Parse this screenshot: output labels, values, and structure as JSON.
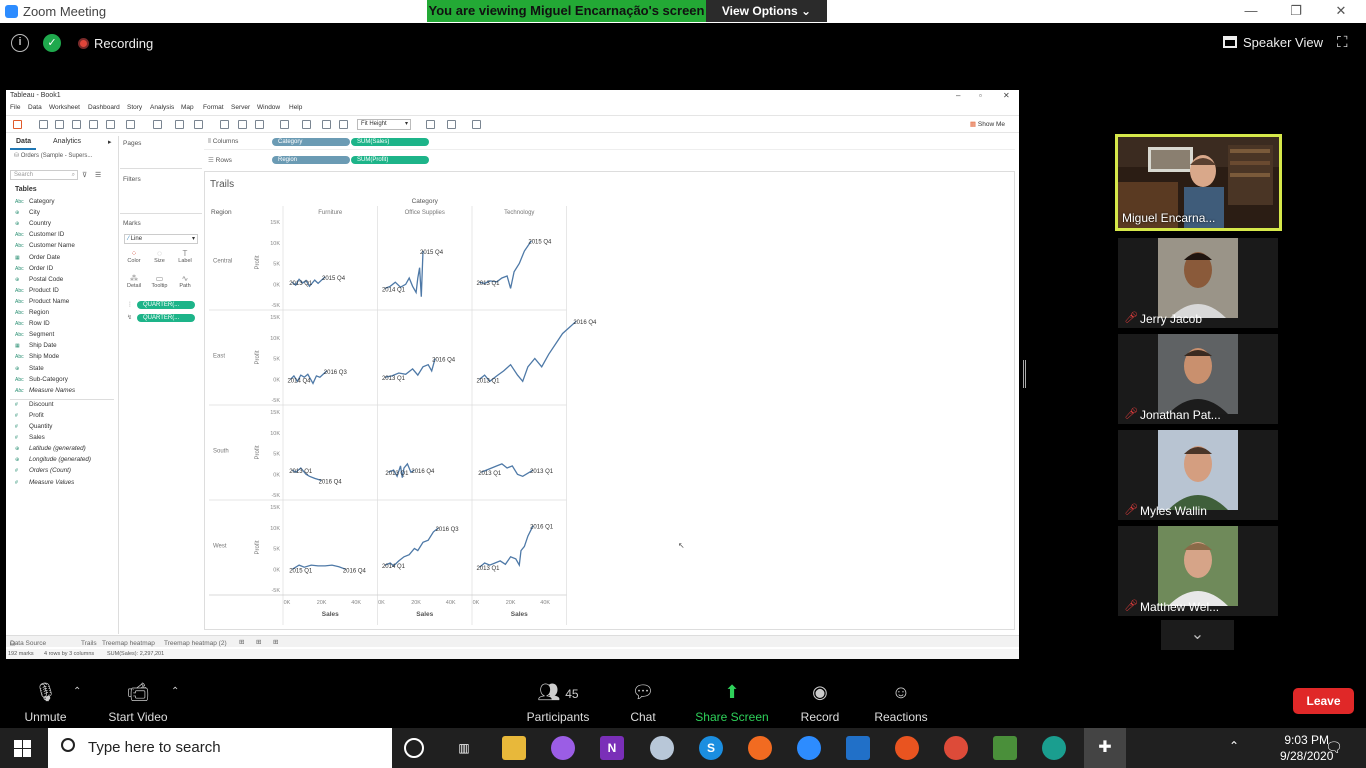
{
  "zoom": {
    "title": "Zoom Meeting",
    "banner": "You are viewing Miguel Encarnação's screen",
    "view_options": "View Options",
    "recording": "Recording",
    "speaker_view": "Speaker View"
  },
  "tableau": {
    "window_title": "Tableau - Book1",
    "menu": [
      "File",
      "Data",
      "Worksheet",
      "Dashboard",
      "Story",
      "Analysis",
      "Map",
      "Format",
      "Server",
      "Window",
      "Help"
    ],
    "fit": "Fit Height",
    "show_me": "Show Me",
    "data_tab": "Data",
    "analytics_tab": "Analytics",
    "datasource": "Orders (Sample - Supers...",
    "search_placeholder": "Search",
    "tables_heading": "Tables",
    "dimensions": [
      "Category",
      "City",
      "Country",
      "Customer ID",
      "Customer Name",
      "Order Date",
      "Order ID",
      "Postal Code",
      "Product ID",
      "Product Name",
      "Region",
      "Row ID",
      "Segment",
      "Ship Date",
      "Ship Mode",
      "State",
      "Sub-Category",
      "Measure Names"
    ],
    "measures": [
      "Discount",
      "Profit",
      "Quantity",
      "Sales",
      "Latitude (generated)",
      "Longitude (generated)",
      "Orders (Count)",
      "Measure Values"
    ],
    "pages": "Pages",
    "filters": "Filters",
    "marks": "Marks",
    "mark_type": "Line",
    "mark_buttons": [
      "Color",
      "Size",
      "Label",
      "Detail",
      "Tooltip",
      "Path"
    ],
    "mark_pills": [
      "QUARTER(...",
      "QUARTER(..."
    ],
    "columns_label": "Columns",
    "rows_label": "Rows",
    "columns_pills": [
      "Category",
      "SUM(Sales)"
    ],
    "rows_pills": [
      "Region",
      "SUM(Profit)"
    ],
    "sheet_title": "Trails",
    "bottom_tabs": [
      "Data Source",
      "Trails",
      "Treemap heatmap",
      "Treemap heatmap (2)"
    ],
    "status": [
      "192 marks",
      "4 rows by 3 columns",
      "SUM(Sales): 2,297,201"
    ]
  },
  "chart_data": {
    "type": "line",
    "title": "Trails",
    "column_header": "Category",
    "row_header": "Region",
    "categories": [
      "Furniture",
      "Office Supplies",
      "Technology"
    ],
    "regions": [
      "Central",
      "East",
      "South",
      "West"
    ],
    "xlabel": "Sales",
    "ylabel": "Profit",
    "x_ticks": [
      "0K",
      "20K",
      "40K"
    ],
    "y_ticks": [
      "15K",
      "10K",
      "5K",
      "0K",
      "-5K"
    ],
    "xlim": [
      0,
      50000
    ],
    "ylim": [
      -5000,
      15000
    ],
    "panels": [
      {
        "region": "Central",
        "category": "Furniture",
        "points": [
          [
            3000,
            500
          ],
          [
            5000,
            -200
          ],
          [
            7000,
            1200
          ],
          [
            9000,
            300
          ],
          [
            11000,
            900
          ],
          [
            13000,
            -500
          ],
          [
            16000,
            1000
          ],
          [
            18000,
            200
          ],
          [
            22000,
            1800
          ]
        ],
        "labels": [
          {
            "text": "2013 Q1",
            "x": 3000,
            "y": 500
          },
          {
            "text": "2015 Q4",
            "x": 22000,
            "y": 1800
          }
        ]
      },
      {
        "region": "Central",
        "category": "Office Supplies",
        "points": [
          [
            2000,
            -1000
          ],
          [
            5000,
            -500
          ],
          [
            8000,
            500
          ],
          [
            11000,
            -700
          ],
          [
            14000,
            0
          ],
          [
            16000,
            1500
          ],
          [
            18000,
            -500
          ],
          [
            20000,
            -2000
          ],
          [
            21000,
            1500
          ],
          [
            22000,
            4000
          ],
          [
            23000,
            -3000
          ],
          [
            24000,
            8000
          ]
        ],
        "labels": [
          {
            "text": "2014 Q1",
            "x": 2000,
            "y": -1000
          },
          {
            "text": "2015 Q4",
            "x": 24000,
            "y": 8000
          }
        ]
      },
      {
        "region": "Central",
        "category": "Technology",
        "points": [
          [
            2000,
            500
          ],
          [
            5000,
            200
          ],
          [
            8000,
            800
          ],
          [
            12000,
            600
          ],
          [
            15000,
            1500
          ],
          [
            18000,
            2000
          ],
          [
            20000,
            -1000
          ],
          [
            22000,
            3000
          ],
          [
            25000,
            5000
          ],
          [
            28000,
            8000
          ],
          [
            32000,
            10500
          ]
        ],
        "labels": [
          {
            "text": "2013 Q1",
            "x": 2000,
            "y": 500
          },
          {
            "text": "2015 Q4",
            "x": 32000,
            "y": 10500
          }
        ]
      },
      {
        "region": "East",
        "category": "Furniture",
        "points": [
          [
            2000,
            0
          ],
          [
            4000,
            800
          ],
          [
            6000,
            -500
          ],
          [
            8000,
            1000
          ],
          [
            10000,
            500
          ],
          [
            12000,
            1200
          ],
          [
            15000,
            -1000
          ],
          [
            17000,
            800
          ],
          [
            19000,
            500
          ],
          [
            23000,
            2000
          ]
        ],
        "labels": [
          {
            "text": "2014 Q4",
            "x": 2000,
            "y": 0
          },
          {
            "text": "2016 Q3",
            "x": 23000,
            "y": 2000
          }
        ]
      },
      {
        "region": "East",
        "category": "Office Supplies",
        "points": [
          [
            2000,
            500
          ],
          [
            6000,
            800
          ],
          [
            10000,
            1500
          ],
          [
            14000,
            1200
          ],
          [
            18000,
            2500
          ],
          [
            21000,
            1000
          ],
          [
            24000,
            3000
          ],
          [
            27000,
            3500
          ],
          [
            29000,
            2000
          ],
          [
            31000,
            5000
          ]
        ],
        "labels": [
          {
            "text": "2013 Q1",
            "x": 2000,
            "y": 500
          },
          {
            "text": "2016 Q4",
            "x": 31000,
            "y": 5000
          }
        ]
      },
      {
        "region": "East",
        "category": "Technology",
        "points": [
          [
            2000,
            0
          ],
          [
            5000,
            1000
          ],
          [
            8000,
            -500
          ],
          [
            12000,
            800
          ],
          [
            16000,
            2000
          ],
          [
            20000,
            3500
          ],
          [
            24000,
            1000
          ],
          [
            27000,
            -500
          ],
          [
            30000,
            3000
          ],
          [
            34000,
            5000
          ],
          [
            38000,
            3000
          ],
          [
            42000,
            6000
          ],
          [
            50000,
            11000
          ],
          [
            58000,
            14000
          ]
        ],
        "labels": [
          {
            "text": "2013 Q1",
            "x": 2000,
            "y": 0
          },
          {
            "text": "2016 Q4",
            "x": 58000,
            "y": 14000
          }
        ]
      },
      {
        "region": "South",
        "category": "Furniture",
        "points": [
          [
            3000,
            1000
          ],
          [
            5000,
            500
          ],
          [
            8000,
            1500
          ],
          [
            11000,
            0
          ],
          [
            13000,
            -500
          ],
          [
            16000,
            -1000
          ],
          [
            20000,
            -1500
          ]
        ],
        "labels": [
          {
            "text": "2013 Q1",
            "x": 3000,
            "y": 1000
          },
          {
            "text": "2016 Q4",
            "x": 20000,
            "y": -1500
          }
        ]
      },
      {
        "region": "South",
        "category": "Office Supplies",
        "points": [
          [
            4000,
            500
          ],
          [
            7000,
            1000
          ],
          [
            9000,
            -500
          ],
          [
            11000,
            2000
          ],
          [
            12000,
            -800
          ],
          [
            13000,
            1500
          ],
          [
            15000,
            2500
          ],
          [
            17000,
            500
          ],
          [
            19000,
            1000
          ]
        ],
        "labels": [
          {
            "text": "2013 Q1",
            "x": 4000,
            "y": 500
          },
          {
            "text": "2016 Q4",
            "x": 19000,
            "y": 1000
          }
        ]
      },
      {
        "region": "South",
        "category": "Technology",
        "points": [
          [
            3000,
            500
          ],
          [
            6000,
            1000
          ],
          [
            9000,
            1500
          ],
          [
            12000,
            2000
          ],
          [
            15000,
            2500
          ],
          [
            18000,
            1500
          ],
          [
            21000,
            2000
          ],
          [
            24000,
            0
          ],
          [
            27000,
            -500
          ],
          [
            33000,
            1000
          ]
        ],
        "labels": [
          {
            "text": "2013 Q1",
            "x": 3000,
            "y": 500
          },
          {
            "text": "2013 Q1",
            "x": 33000,
            "y": 1000
          }
        ]
      },
      {
        "region": "West",
        "category": "Furniture",
        "points": [
          [
            3000,
            0
          ],
          [
            5000,
            500
          ],
          [
            7000,
            1000
          ],
          [
            10000,
            500
          ],
          [
            14000,
            1000
          ],
          [
            18000,
            800
          ],
          [
            22000,
            800
          ],
          [
            26000,
            1000
          ],
          [
            30000,
            600
          ],
          [
            34000,
            0
          ]
        ],
        "labels": [
          {
            "text": "2015 Q1",
            "x": 3000,
            "y": 0
          },
          {
            "text": "2016 Q4",
            "x": 34000,
            "y": 0
          }
        ]
      },
      {
        "region": "West",
        "category": "Office Supplies",
        "points": [
          [
            2000,
            1000
          ],
          [
            5000,
            1500
          ],
          [
            7000,
            800
          ],
          [
            10000,
            2000
          ],
          [
            13000,
            3000
          ],
          [
            16000,
            3500
          ],
          [
            19000,
            5000
          ],
          [
            21000,
            4500
          ],
          [
            24000,
            6500
          ],
          [
            27000,
            7000
          ],
          [
            30000,
            9000
          ],
          [
            33000,
            10000
          ]
        ],
        "labels": [
          {
            "text": "2014 Q1",
            "x": 2000,
            "y": 1000
          },
          {
            "text": "2016 Q3",
            "x": 33000,
            "y": 10000
          }
        ]
      },
      {
        "region": "West",
        "category": "Technology",
        "points": [
          [
            2000,
            500
          ],
          [
            5000,
            1500
          ],
          [
            8000,
            1000
          ],
          [
            11000,
            1500
          ],
          [
            14000,
            2000
          ],
          [
            17000,
            1200
          ],
          [
            20000,
            3000
          ],
          [
            23000,
            2500
          ],
          [
            25000,
            1000
          ],
          [
            26000,
            4500
          ],
          [
            28000,
            5500
          ],
          [
            30000,
            8000
          ],
          [
            33000,
            10500
          ]
        ],
        "labels": [
          {
            "text": "2013 Q1",
            "x": 2000,
            "y": 500
          },
          {
            "text": "2016 Q1",
            "x": 33000,
            "y": 10500
          }
        ]
      }
    ]
  },
  "participants": {
    "active": "Miguel Encarna...",
    "others": [
      "Jerry Jacob",
      "Jonathan Pat...",
      "Myles Wallin",
      "Matthew Wel..."
    ]
  },
  "controls": {
    "unmute": "Unmute",
    "start_video": "Start Video",
    "participants_count": "45",
    "participants": "Participants",
    "chat": "Chat",
    "share_screen": "Share Screen",
    "record": "Record",
    "reactions": "Reactions",
    "leave": "Leave"
  },
  "taskbar": {
    "search_placeholder": "Type here to search",
    "time": "9:03 PM",
    "date": "9/28/2020"
  }
}
